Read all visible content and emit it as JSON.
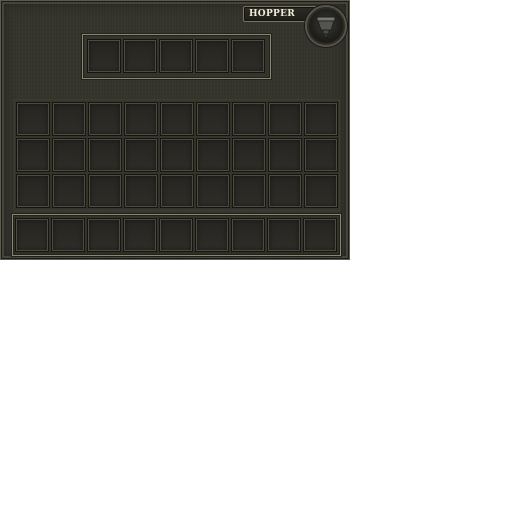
{
  "window": {
    "title": "HOPPER"
  },
  "emblem": {
    "icon": "hopper-icon"
  },
  "hopper_slots": {
    "count": 5
  },
  "inventory": {
    "rows": 3,
    "columns": 9
  },
  "hotbar": {
    "columns": 9
  },
  "colors": {
    "panel": "#34332c",
    "slot": "#2a2924",
    "frame": "#8a8670",
    "title_text": "#f1ecd8"
  }
}
